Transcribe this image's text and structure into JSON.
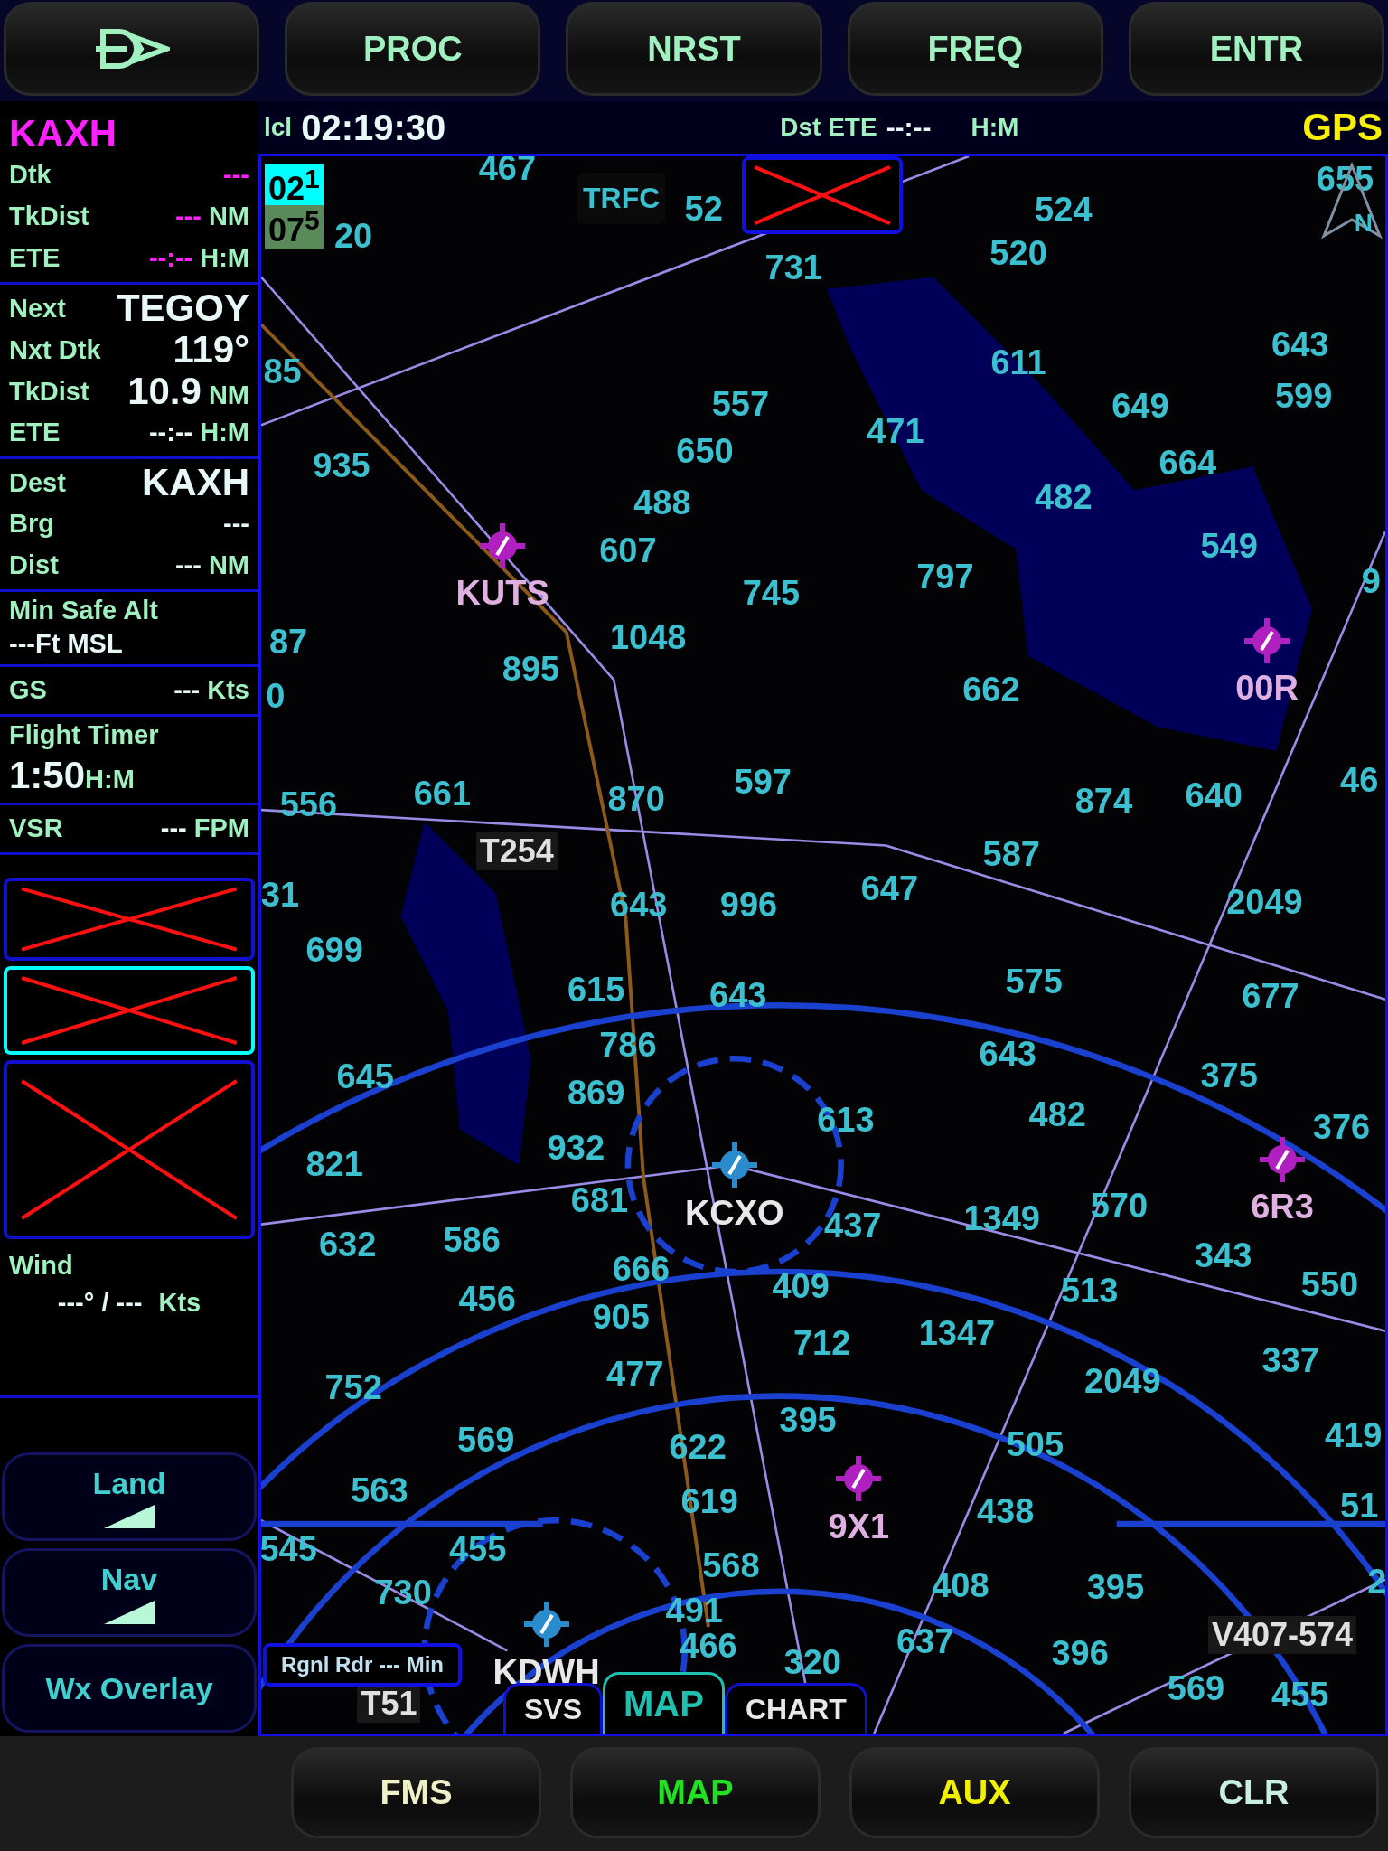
{
  "top_buttons": [
    {
      "kind": "direct_to"
    },
    {
      "kind": "text",
      "label": "PROC"
    },
    {
      "kind": "text",
      "label": "NRST"
    },
    {
      "kind": "text",
      "label": "FREQ"
    },
    {
      "kind": "text",
      "label": "ENTR"
    }
  ],
  "info_bar": {
    "clock_label": "lcl",
    "clock": "02:19:30",
    "dst_label": "Dst ETE",
    "dst_value": "--:--",
    "dst_unit": "H:M",
    "source": "GPS"
  },
  "flight_plan": {
    "active_waypoint": "KAXH",
    "sections": [
      {
        "kind": "rows",
        "active_leg": true,
        "rows": [
          {
            "label": "Dtk",
            "value": "---"
          },
          {
            "label": "TkDist",
            "value": "---",
            "unit": "NM"
          },
          {
            "label": "ETE",
            "value": "--:--",
            "unit": "H:M"
          }
        ]
      },
      {
        "kind": "rows",
        "active_leg": false,
        "rows": [
          {
            "label": "Next",
            "value": "TEGOY",
            "emphasis": true
          },
          {
            "label": "Nxt Dtk",
            "value": "119°",
            "emphasis": true
          },
          {
            "label": "TkDist",
            "value": "10.9",
            "unit": "NM",
            "emphasis": true
          },
          {
            "label": "ETE",
            "value": "--:--",
            "unit": "H:M"
          }
        ]
      },
      {
        "kind": "rows",
        "active_leg": false,
        "rows": [
          {
            "label": "Dest",
            "value": "KAXH",
            "emphasis": true
          },
          {
            "label": "Brg",
            "value": "---"
          },
          {
            "label": "Dist",
            "value": "---",
            "unit": "NM"
          }
        ]
      },
      {
        "kind": "stacked",
        "label": "Min Safe Alt",
        "value": "---Ft MSL"
      },
      {
        "kind": "rows",
        "active_leg": false,
        "rows": [
          {
            "label": "GS",
            "value": "---",
            "unit": "Kts"
          }
        ]
      },
      {
        "kind": "stacked",
        "label": "Flight Timer",
        "value": "1:50",
        "unit": "H:M",
        "emphasis": true
      },
      {
        "kind": "rows",
        "active_leg": false,
        "rows": [
          {
            "label": "VSR",
            "value": "---",
            "unit": "FPM"
          }
        ]
      }
    ]
  },
  "failed_panels": [
    {
      "selected": false
    },
    {
      "selected": true
    },
    {
      "selected": false
    }
  ],
  "wind": {
    "label": "Wind",
    "value": "---° / ---",
    "unit": "Kts"
  },
  "soft_buttons": [
    {
      "label": "Land",
      "kind": "ramp"
    },
    {
      "label": "Nav",
      "kind": "ramp"
    },
    {
      "label": "Wx Overlay",
      "kind": "plain"
    }
  ],
  "map": {
    "range_badges": [
      {
        "text": "02$^{1}$",
        "color": "#00ffff"
      },
      {
        "text": "07$^{5}$",
        "color": "#5a8a5a"
      }
    ],
    "traffic_label": "TRFC",
    "north_label": "N",
    "radar_label": "Rgnl Rdr --- Min",
    "elevations": [
      "20",
      "467",
      "52",
      "731",
      "520",
      "524",
      "655",
      "85",
      "611",
      "643",
      "557",
      "471",
      "649",
      "599",
      "935",
      "650",
      "664",
      "488",
      "482",
      "607",
      "549",
      "745",
      "797",
      "9",
      "87",
      "895",
      "1048",
      "0",
      "662",
      "556",
      "661",
      "870",
      "597",
      "874",
      "640",
      "46",
      "587",
      "31",
      "643",
      "996",
      "647",
      "2049",
      "699",
      "615",
      "643",
      "575",
      "677",
      "645",
      "869",
      "786",
      "643",
      "375",
      "821",
      "932",
      "613",
      "482",
      "376",
      "632",
      "586",
      "681",
      "437",
      "1349",
      "570",
      "343",
      "456",
      "905",
      "666",
      "409",
      "513",
      "550",
      "752",
      "477",
      "712",
      "1347",
      "2049",
      "337",
      "569",
      "622",
      "395",
      "505",
      "419",
      "563",
      "619",
      "438",
      "51",
      "545",
      "730",
      "455",
      "568",
      "408",
      "395",
      "2",
      "491",
      "466",
      "320",
      "637",
      "396",
      "569",
      "455"
    ],
    "airports": [
      {
        "label": "KUTS",
        "color": "#b020c0"
      },
      {
        "label": "00R",
        "color": "#b020c0"
      },
      {
        "label": "6R3",
        "color": "#b020c0"
      },
      {
        "label": "KCXO",
        "color": "#2a8ccc"
      },
      {
        "label": "9X1",
        "color": "#b020c0"
      },
      {
        "label": "KDWH",
        "color": "#2a8ccc"
      }
    ],
    "airways": [
      "T254",
      "V407-574",
      "T51"
    ],
    "tabs": [
      {
        "label": "SVS",
        "selected": false
      },
      {
        "label": "MAP",
        "selected": true
      },
      {
        "label": "CHART",
        "selected": false
      }
    ]
  },
  "bottom_buttons": [
    {
      "label": "FMS",
      "color": "#f0f0c8"
    },
    {
      "label": "MAP",
      "color": "#20e020"
    },
    {
      "label": "AUX",
      "color": "#f0f000"
    },
    {
      "label": "CLR",
      "color": "#c8f0e0"
    }
  ]
}
